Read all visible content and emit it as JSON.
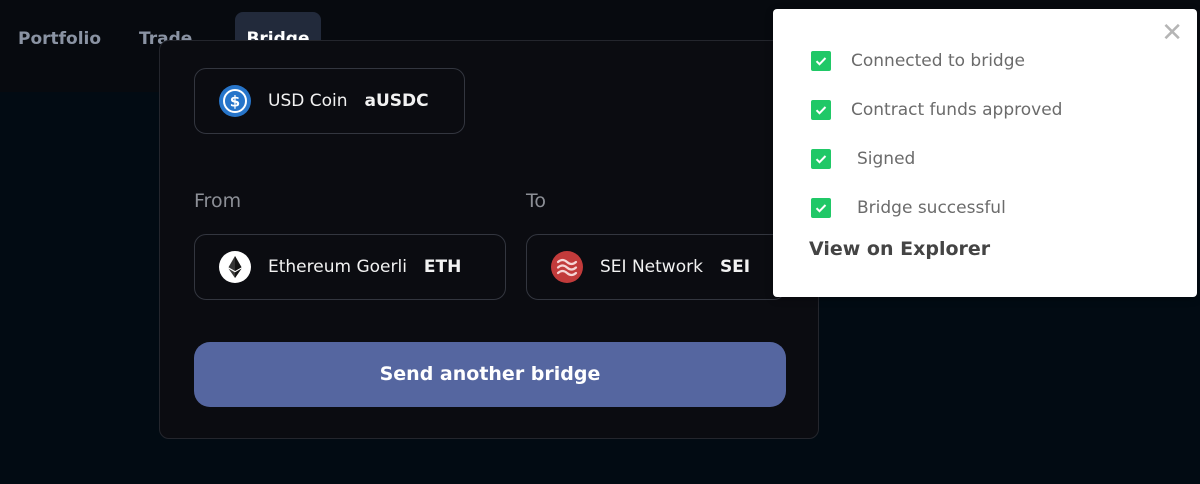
{
  "nav": {
    "tabs": [
      {
        "label": "Portfolio",
        "active": false
      },
      {
        "label": "Trade",
        "active": false
      },
      {
        "label": "Bridge",
        "active": true
      }
    ]
  },
  "bridge": {
    "token": {
      "name": "USD Coin",
      "symbol": "aUSDC",
      "icon": "usdc-coin-icon"
    },
    "from_label": "From",
    "to_label": "To",
    "from": {
      "name": "Ethereum Goerli",
      "symbol": "ETH",
      "icon": "ethereum-icon"
    },
    "to": {
      "name": "SEI Network",
      "symbol": "SEI",
      "icon": "sei-icon"
    },
    "send_button_label": "Send another bridge"
  },
  "toast": {
    "close_icon": "close-icon",
    "steps": [
      {
        "label": "Connected to bridge",
        "done": true
      },
      {
        "label": "Contract funds approved",
        "done": true
      },
      {
        "label": "Signed",
        "done": true
      },
      {
        "label": "Bridge successful",
        "done": true
      }
    ],
    "explorer_link": "View on Explorer"
  },
  "colors": {
    "background": "#020b13",
    "nav_background": "#070a0f",
    "active_tab": "#222a3b",
    "card_background": "#0b0c11",
    "button": "#5566a0",
    "check_green": "#20c867",
    "usdc_blue": "#2775ca",
    "sei_red": "#c23b3b"
  }
}
